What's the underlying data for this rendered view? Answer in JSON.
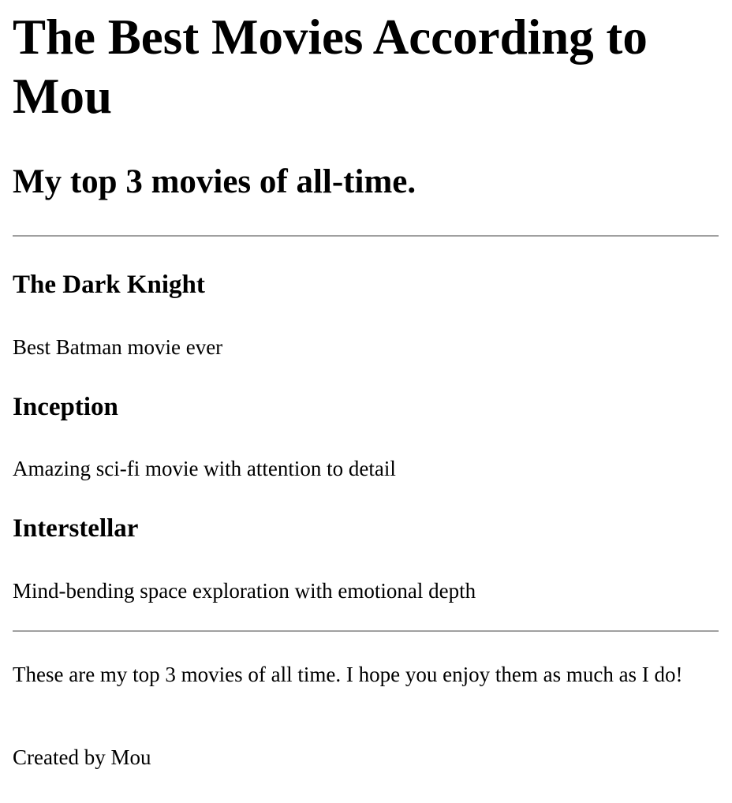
{
  "header": {
    "title": "The Best Movies According to Mou",
    "subtitle": "My top 3 movies of all-time."
  },
  "movies": [
    {
      "title": "The Dark Knight",
      "description": "Best Batman movie ever"
    },
    {
      "title": "Inception",
      "description": "Amazing sci-fi movie with attention to detail"
    },
    {
      "title": "Interstellar",
      "description": "Mind-bending space exploration with emotional depth"
    }
  ],
  "footer": {
    "text": "These are my top 3 movies of all time. I hope you enjoy them as much as I do!",
    "credit": "Created by Mou"
  }
}
